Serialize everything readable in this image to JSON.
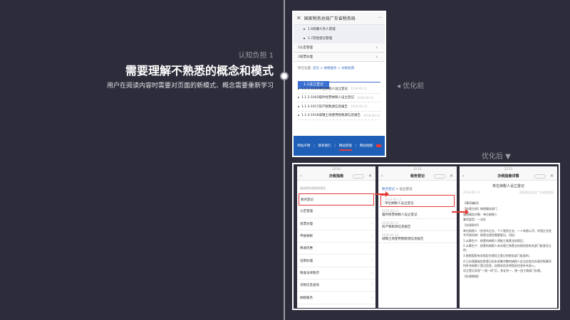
{
  "slide": {
    "label": "认知负担 1",
    "headline": "需要理解不熟悉的概念和模式",
    "description": "用户在阅读内容时需要对页面的新模式、概念需要重新学习",
    "before_label": "◂ 优化前",
    "after_label": "优化后 ▼"
  },
  "colors": {
    "background": "#2c2c3a",
    "accent_blue": "#1f5fb8",
    "tab_blue": "#3b6fd1",
    "highlight_red": "#e53935"
  },
  "before": {
    "header_title": "国家税务总局广东省税务局",
    "close_icon": "✕",
    "more_icon": "···",
    "sub_items": [
      "1.6扣缴义务人管理",
      "1.7其他登记管理"
    ],
    "rows": [
      {
        "label": "2认定管理",
        "arrow": "›"
      },
      {
        "label": "3发票办理",
        "arrow": "›"
      }
    ],
    "crumb_prefix": "所在位置:",
    "crumb_links": "首页 > 纳税服务 > 办税指南",
    "active_tab": "1.1设立登记",
    "list": [
      {
        "title": "1.1.1-1000单位纳税人设立登记",
        "date": "2018-06-13"
      },
      {
        "title": "1.1.2-1002临时经营纳税人设立登记",
        "date": "2018-06-13"
      },
      {
        "title": "1.1.3-1917房产税税源信息报告",
        "date": "2018-06-13"
      },
      {
        "title": "1.1.4-1918城镇土地使用税税源信息报告",
        "date": "2018-06-13"
      }
    ],
    "footer_links": [
      "网站声明",
      "联系我们",
      "网站管理",
      "网站地图"
    ],
    "footer_sep": "|"
  },
  "after": {
    "status_times": [
      "22:50",
      "22:51",
      "22:53"
    ],
    "phone1": {
      "title": "办税指南",
      "back": "‹",
      "close": "✕",
      "hint": "请选择办税指南类型",
      "items": [
        "税务登记",
        "认定管理",
        "发票办理",
        "申报纳税",
        "税收优惠",
        "证明办理",
        "税收法律救济",
        "涉税信息查询",
        "纳税服务"
      ],
      "chevron": "›"
    },
    "phone2": {
      "title": "税务登记",
      "back": "‹",
      "close": "✕",
      "crumb_a": "税务登记",
      "crumb_sep": " > ",
      "crumb_b": "设立登记",
      "entries": [
        {
          "date": "2018-06-13",
          "title": "单位纳税人设立登记"
        },
        {
          "date": "2018-06-13",
          "title": "临时经营纳税人设立登记"
        },
        {
          "date": "2018-06-13",
          "title": "房产税税源信息报告"
        },
        {
          "date": "2018-06-13",
          "title": "城镇土地使用税税源信息报告"
        }
      ]
    },
    "phone3": {
      "title": "办税指南详情",
      "back": "‹",
      "close": "✕",
      "doc_title": "单位纳税人设立登记",
      "meta_left": "2018-06-13",
      "meta_right": "国家税务总局广东省税务局",
      "body": [
        "【事项编码】",
        "【办理主体】纳税服务部门",
        "管理服务对象：单位纳税人",
        "事项类型：一次办",
        "【办理条件】",
        "单位纳税人（含合伙企业、个人独资企业、一人有限公司、外国企业驻华代表机构）依税法规定需要登记。包括：",
        "1.从事生产、经营的纳税人领取工商营业执照后；",
        "2.从事生产、经营的纳税人未办理工商营业执照但经有关部门批准设立的；",
        "3.按照国家有关规定办理设立登记的税务部门批准的；",
        "4.已办理基础信息登记但未采集完整的纳税人应当在首次办理涉税事项时补充纳税人登记信息，由税务机关将相关信息补充录入。",
        "设立登记实现“一照一码”后，多证合一，统一由工商部门办理。",
        "【办理期限】"
      ]
    }
  }
}
